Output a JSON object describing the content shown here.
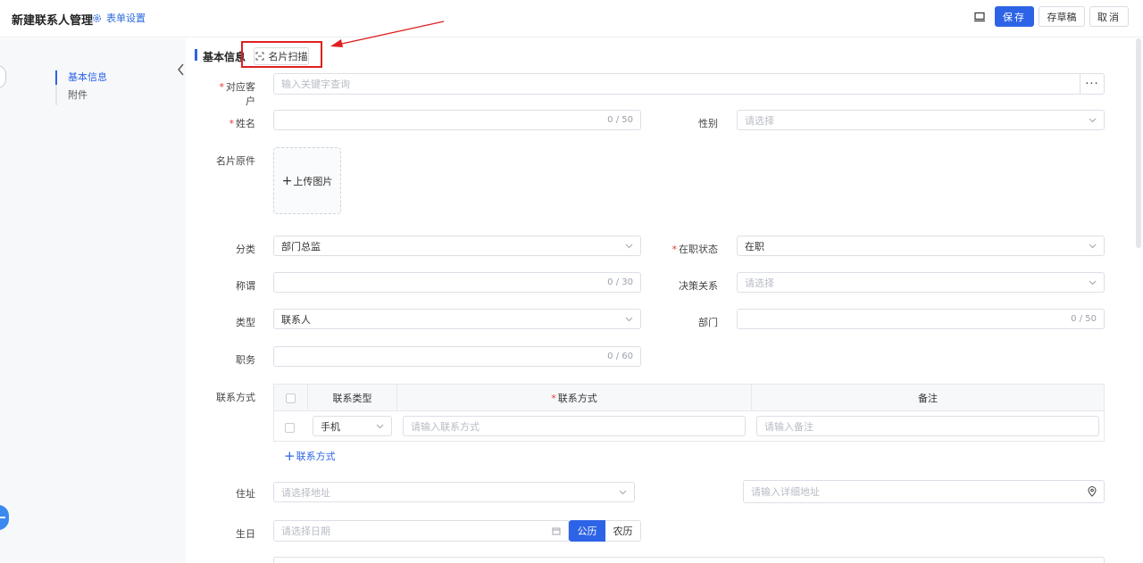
{
  "header": {
    "title": "新建联系人管理",
    "form_settings": "表单设置",
    "save": "保存",
    "draft": "存草稿",
    "cancel": "取消"
  },
  "nav": {
    "items": [
      {
        "label": "基本信息",
        "active": true
      },
      {
        "label": "附件",
        "active": false
      }
    ]
  },
  "section": {
    "title": "基本信息",
    "scan_button": "名片扫描"
  },
  "form": {
    "customer": {
      "label": "对应客户",
      "placeholder": "输入关键字查询",
      "required": true
    },
    "name": {
      "label": "姓名",
      "counter": "0 / 50",
      "required": true
    },
    "gender": {
      "label": "性别",
      "placeholder": "请选择"
    },
    "card_original": {
      "label": "名片原件",
      "upload": "上传图片"
    },
    "category": {
      "label": "分类",
      "value": "部门总监"
    },
    "employment": {
      "label": "在职状态",
      "value": "在职",
      "required": true
    },
    "salutation": {
      "label": "称谓",
      "counter": "0 / 30"
    },
    "decision": {
      "label": "决策关系",
      "placeholder": "请选择"
    },
    "type": {
      "label": "类型",
      "value": "联系人"
    },
    "department": {
      "label": "部门",
      "counter": "0 / 50"
    },
    "position": {
      "label": "职务",
      "counter": "0 / 60"
    },
    "contact": {
      "label": "联系方式",
      "columns": [
        "联系类型",
        "联系方式",
        "备注"
      ],
      "row": {
        "type": "手机",
        "method_placeholder": "请输入联系方式",
        "note_placeholder": "请输入备注"
      },
      "add": "联系方式"
    },
    "address": {
      "label": "住址",
      "placeholder": "请选择地址",
      "detail_placeholder": "请输入详细地址"
    },
    "birthday": {
      "label": "生日",
      "placeholder": "请选择日期",
      "solar": "公历",
      "lunar": "农历"
    }
  },
  "colors": {
    "primary": "#2d63e6",
    "required": "#e53935",
    "annotation": "#e02020"
  }
}
